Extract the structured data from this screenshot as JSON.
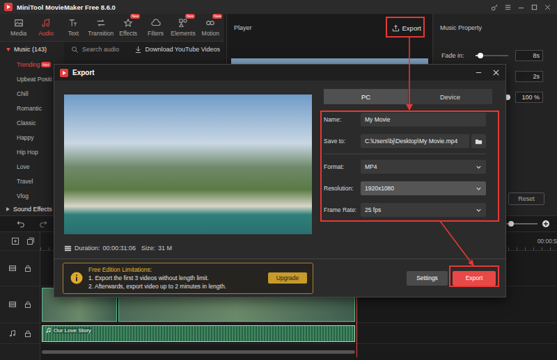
{
  "app": {
    "title": "MiniTool MovieMaker Free 8.6.0"
  },
  "toolbar": [
    {
      "label": "Media",
      "selected": false,
      "badge": ""
    },
    {
      "label": "Audio",
      "selected": true,
      "badge": ""
    },
    {
      "label": "Text",
      "selected": false,
      "badge": ""
    },
    {
      "label": "Transition",
      "selected": false,
      "badge": ""
    },
    {
      "label": "Effects",
      "selected": false,
      "badge": "New"
    },
    {
      "label": "Filters",
      "selected": false,
      "badge": ""
    },
    {
      "label": "Elements",
      "selected": false,
      "badge": "New"
    },
    {
      "label": "Motion",
      "selected": false,
      "badge": "New"
    }
  ],
  "library": {
    "category": "Music (143)",
    "expanded": true,
    "search_placeholder": "Search audio",
    "download": "Download YouTube Videos",
    "items": [
      {
        "label": "Trending",
        "selected": true,
        "badge": "Hot"
      },
      {
        "label": "Upbeat Positi",
        "selected": false,
        "badge": ""
      },
      {
        "label": "Chill",
        "selected": false,
        "badge": ""
      },
      {
        "label": "Romantic",
        "selected": false,
        "badge": ""
      },
      {
        "label": "Classic",
        "selected": false,
        "badge": ""
      },
      {
        "label": "Happy",
        "selected": false,
        "badge": ""
      },
      {
        "label": "Hip Hop",
        "selected": false,
        "badge": ""
      },
      {
        "label": "Love",
        "selected": false,
        "badge": ""
      },
      {
        "label": "Travel",
        "selected": false,
        "badge": ""
      },
      {
        "label": "Vlog",
        "selected": false,
        "badge": ""
      }
    ],
    "next_category": "Sound Effects",
    "next_expanded": false
  },
  "player": {
    "title": "Player",
    "export_button": "Export"
  },
  "property": {
    "title": "Music Property",
    "rows": [
      {
        "label": "Fade in:",
        "level": 0.15,
        "reading": "8s"
      },
      {
        "label": "",
        "level": null,
        "reading": "2s"
      },
      {
        "label": "",
        "level": 0.98,
        "reading": "100 %"
      }
    ],
    "reset": "Reset"
  },
  "timeline": {
    "ruler": "00:00:5",
    "zoom_level": 0.15,
    "audio_clip": "Our Love Story"
  },
  "export_dialog": {
    "title": "Export",
    "duration_label": "Duration:",
    "duration": "00:00:31:06",
    "size_label": "Size:",
    "size": "31 M",
    "targets": [
      {
        "label": "PC",
        "selected": true
      },
      {
        "label": "Device",
        "selected": false
      }
    ],
    "fields": [
      {
        "label": "Name:",
        "value": "My Movie",
        "kind": "text",
        "highlighted": false
      },
      {
        "label": "Save to:",
        "value": "C:\\Users\\bj\\Desktop\\My Movie.mp4",
        "kind": "path",
        "highlighted": false
      },
      {
        "label": "Format:",
        "value": "MP4",
        "kind": "select",
        "highlighted": false
      },
      {
        "label": "Resolution:",
        "value": "1920x1080",
        "kind": "select",
        "highlighted": true
      },
      {
        "label": "Frame Rate:",
        "value": "25 fps",
        "kind": "select",
        "highlighted": false
      }
    ],
    "limitations": {
      "title": "Free Edition Limitations:",
      "lines": [
        "1. Export the first 3 videos without length limit.",
        "2. Afterwards, export video up to 2 minutes in length."
      ],
      "upgrade": "Upgrade"
    },
    "settings": "Settings",
    "export": "Export"
  }
}
